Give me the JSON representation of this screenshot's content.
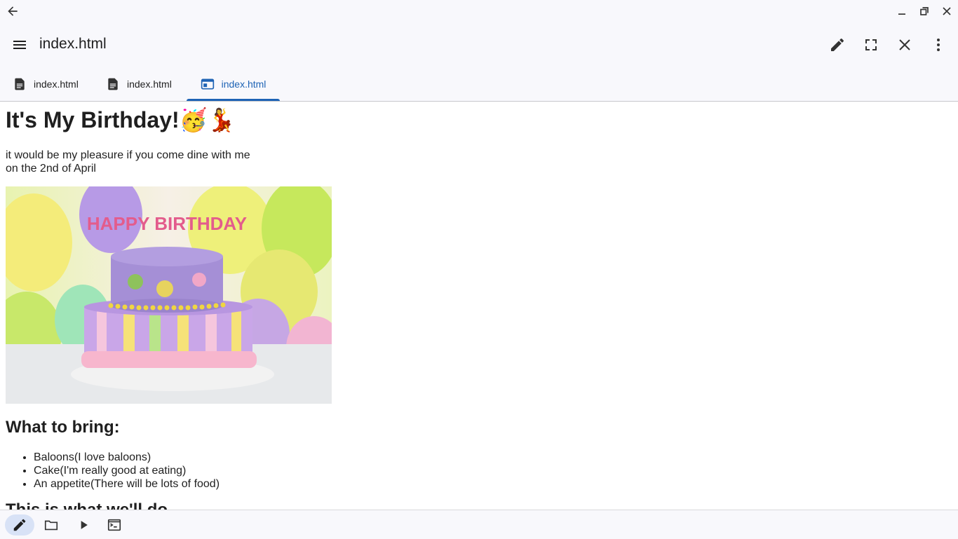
{
  "window": {
    "back_icon": "arrow-left-icon",
    "minimize_icon": "minimize-icon",
    "restore_icon": "restore-icon",
    "close_icon": "close-icon"
  },
  "appbar": {
    "title": "index.html",
    "menu_icon": "hamburger-menu-icon",
    "actions": [
      "edit-icon",
      "fullscreen-icon",
      "close-icon",
      "more-vert-icon"
    ]
  },
  "tabs": [
    {
      "label": "index.html",
      "icon": "document-icon",
      "active": false
    },
    {
      "label": "index.html",
      "icon": "document-icon",
      "active": false
    },
    {
      "label": "index.html",
      "icon": "browser-preview-icon",
      "active": true
    }
  ],
  "page": {
    "heading": "It's My Birthday!🥳💃",
    "message_line1": "it would be my pleasure if you come dine with me",
    "message_line2": "on the 2nd of April",
    "image_text": "HAPPY BIRTHDAY",
    "subheading": "What to bring:",
    "list": [
      "Baloons(I love baloons)",
      "Cake(I'm really good at eating)",
      "An appetite(There will be lots of food)"
    ],
    "next_heading_partial": "This is what we'll do"
  },
  "bottom_nav": [
    {
      "icon": "pencil-icon",
      "active": true
    },
    {
      "icon": "folder-icon",
      "active": false
    },
    {
      "icon": "play-icon",
      "active": false
    },
    {
      "icon": "terminal-icon",
      "active": false
    }
  ],
  "colors": {
    "accent": "#1e63b5",
    "bar_bg": "#f8f8fc"
  }
}
